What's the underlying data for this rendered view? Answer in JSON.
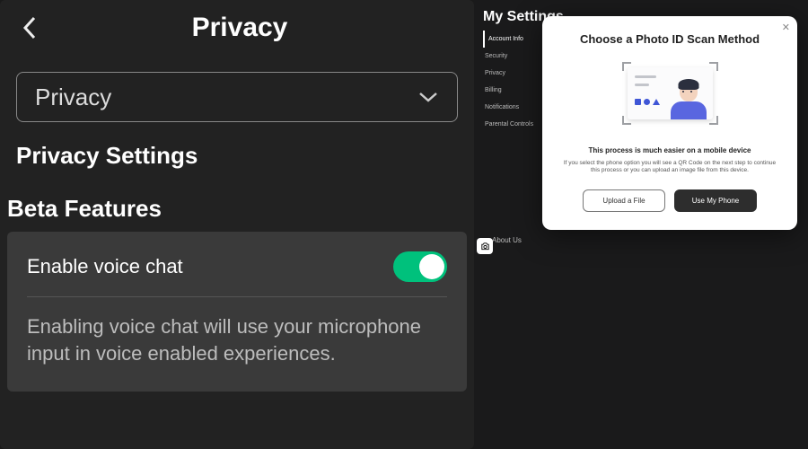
{
  "left": {
    "header_title": "Privacy",
    "dropdown_label": "Privacy",
    "section_title": "Privacy Settings",
    "beta_title": "Beta Features",
    "voice_card": {
      "row_label": "Enable voice chat",
      "toggle_on": true,
      "description": "Enabling voice chat will use your microphone input in voice enabled experiences."
    }
  },
  "right": {
    "page_title": "My Settings",
    "sidebar": [
      "Account Info",
      "Security",
      "Privacy",
      "Billing",
      "Notifications",
      "Parental Controls"
    ],
    "active_sidebar_index": 0,
    "bottom_link": "About Us",
    "modal": {
      "title": "Choose a Photo ID Scan Method",
      "sub1": "This process is much easier on a mobile device",
      "sub2": "If you select the phone option you will see a QR Code on the next step to continue this process or you can upload an image file from this device.",
      "btn_upload": "Upload a File",
      "btn_phone": "Use My Phone"
    }
  }
}
